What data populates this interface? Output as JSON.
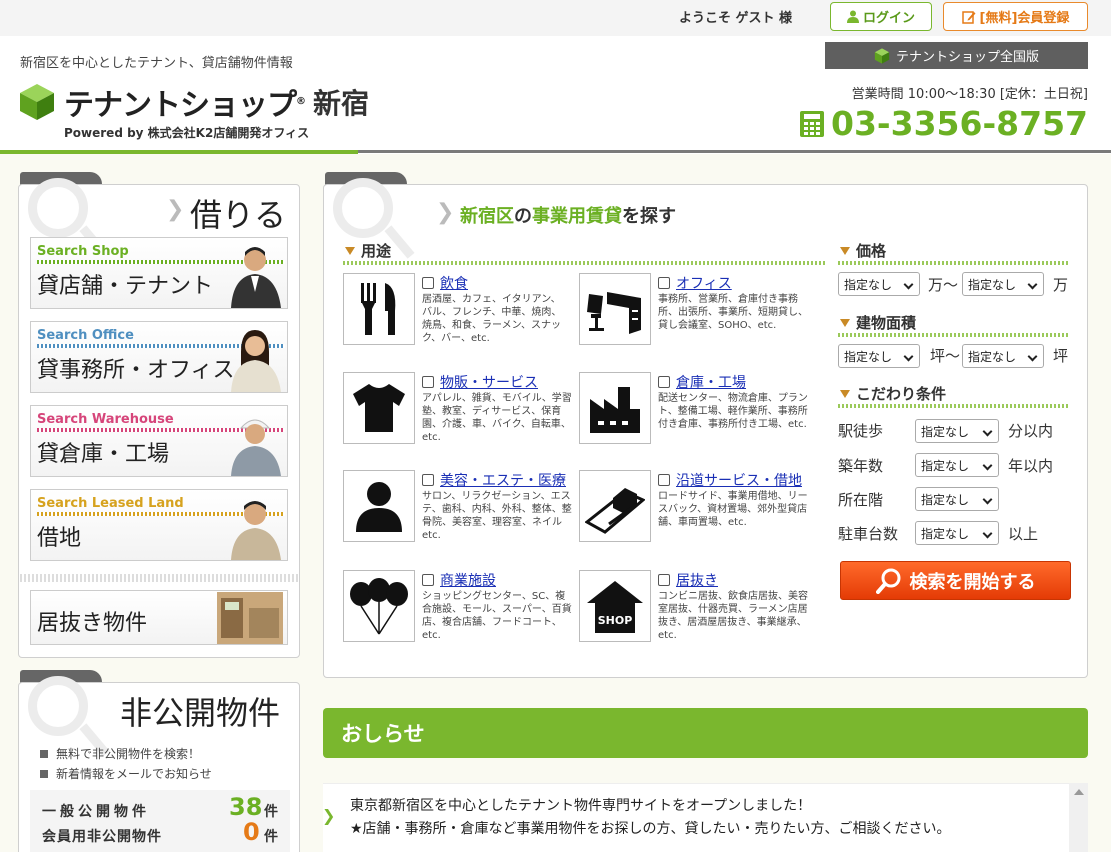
{
  "topbar": {
    "welcome": "ようこそ ゲスト 様",
    "login": "ログイン",
    "register": "[無料]会員登録"
  },
  "header": {
    "tagline": "新宿区を中心としたテナント、貸店舗物件情報",
    "logo_text": "テナントショップ",
    "logo_reg": "®",
    "logo_city": "新宿",
    "powered": "Powered by 株式会社K2店舗開発オフィス",
    "nationwide": "テナントショップ全国版",
    "hours": "営業時間 10:00～18:30 [定休：土日祝]",
    "phone": "03-3356-8757"
  },
  "sidebar": {
    "rent_heading": "借りる",
    "cards": [
      {
        "en": "Search Shop",
        "jp": "貸店舗・テナント",
        "color": "#6bb023"
      },
      {
        "en": "Search Office",
        "jp": "貸事務所・オフィス",
        "color": "#4f8fc0"
      },
      {
        "en": "Search Warehouse",
        "jp": "貸倉庫・工場",
        "color": "#d6457a"
      },
      {
        "en": "Search Leased Land",
        "jp": "借地",
        "color": "#d6a21e"
      }
    ],
    "iinuki": "居抜き物件",
    "private_heading": "非公開物件",
    "private_items": [
      "無料で非公開物件を検索！",
      "新着情報をメールでお知らせ"
    ],
    "counts": [
      {
        "label": "一般公開物件",
        "value": "38",
        "unit": "件",
        "color": "#6bb023"
      },
      {
        "label": "会員用非公開物件",
        "value": "0",
        "unit": "件",
        "color": "#e57a17"
      }
    ]
  },
  "search": {
    "title_a": "新宿区",
    "title_b": "の",
    "title_c": "事業用賃貸",
    "title_d": "を探す",
    "usage_heading": "用途",
    "categories": [
      {
        "name": "飲食",
        "desc": "居酒屋、カフェ、イタリアン、バル、フレンチ、中華、焼肉、焼鳥、和食、ラーメン、スナック、バー、etc.",
        "icon": "fork-knife-icon"
      },
      {
        "name": "オフィス",
        "desc": "事務所、営業所、倉庫付き事務所、出張所、事業所、短期貸し、貸し会議室、SOHO、etc.",
        "icon": "office-desk-icon"
      },
      {
        "name": "物販・サービス",
        "desc": "アパレル、雑貨、モバイル、学習塾、教室、ディサービス、保育園、介護、車、バイク、自転車、etc.",
        "icon": "tshirt-icon"
      },
      {
        "name": "倉庫・工場",
        "desc": "配送センター、物流倉庫、プラント、整備工場、軽作業所、事務所付き倉庫、事務所付き工場、etc.",
        "icon": "factory-icon"
      },
      {
        "name": "美容・エステ・医療",
        "desc": "サロン、リラクゼーション、エステ、歯科、内科、外科、整体、整骨院、美容室、理容室、ネイル etc.",
        "icon": "person-icon"
      },
      {
        "name": "沿道サービス・借地",
        "desc": "ロードサイド、事業用借地、リースバック、資材置場、郊外型貸店舗、車両置場、etc.",
        "icon": "roadside-icon"
      },
      {
        "name": "商業施設",
        "desc": "ショッピングセンター、SC、複合施設、モール、スーパー、百貨店、複合店舗、フードコート、etc.",
        "icon": "balloons-icon"
      },
      {
        "name": "居抜き",
        "desc": "コンビニ居抜、飲食店居抜、美容室居抜、什器売買、ラーメン店居抜き、居酒屋居抜き、事業継承、etc.",
        "icon": "shop-house-icon"
      }
    ],
    "price_heading": "価格",
    "area_heading": "建物面積",
    "pref_heading": "こだわり条件",
    "none": "指定なし",
    "man_tilde": "万～",
    "man": "万",
    "tsubo_tilde": "坪～",
    "tsubo": "坪",
    "conditions": [
      {
        "label": "駅徒歩",
        "suffix": "分以内"
      },
      {
        "label": "築年数",
        "suffix": "年以内"
      },
      {
        "label": "所在階",
        "suffix": ""
      },
      {
        "label": "駐車台数",
        "suffix": "以上"
      }
    ],
    "button": "検索を開始する"
  },
  "news": {
    "heading": "おしらせ",
    "line1": "東京都新宿区を中心としたテナント物件専門サイトをオープンしました！",
    "line2": "★店舗・事務所・倉庫など事業用物件をお探しの方、貸したい・売りたい方、ご相談ください。"
  }
}
